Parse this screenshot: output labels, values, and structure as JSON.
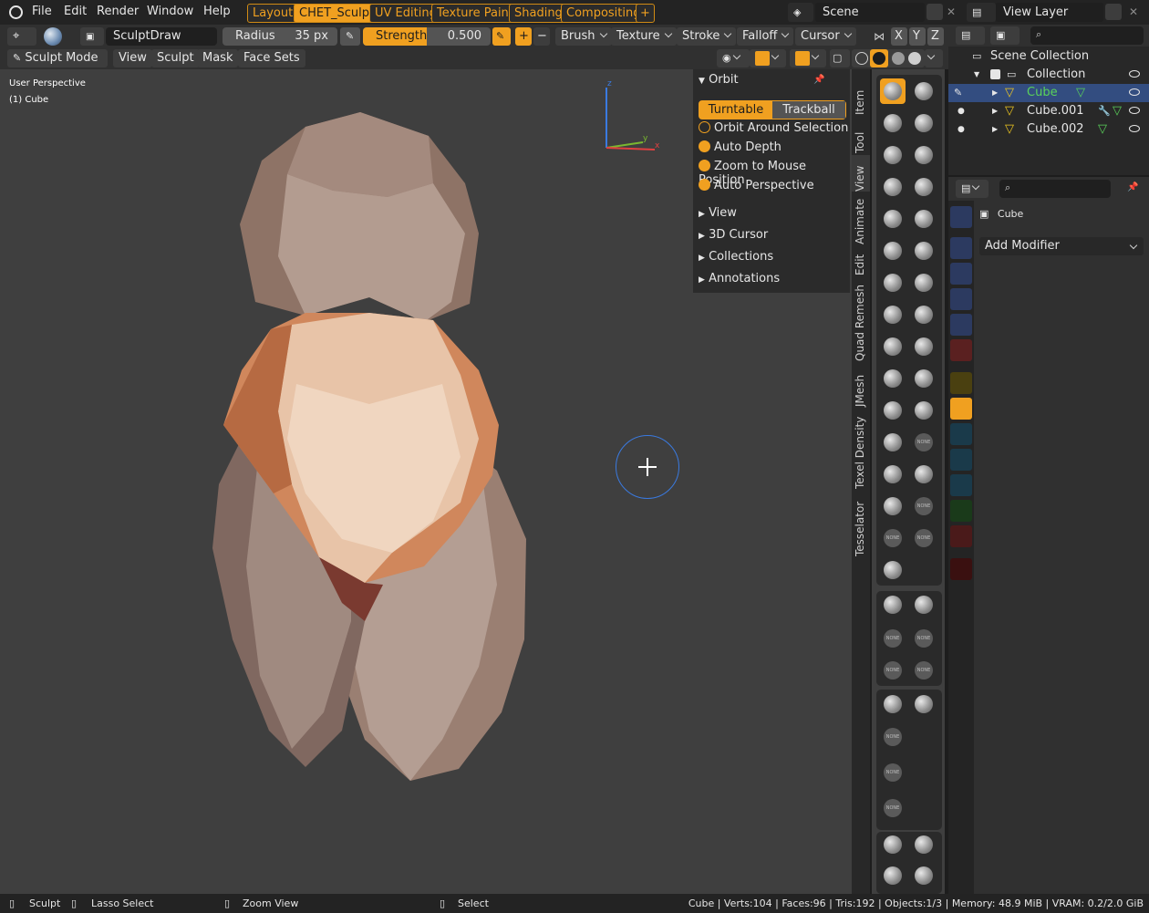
{
  "topbar": {
    "menu": [
      "File",
      "Edit",
      "Render",
      "Window",
      "Help"
    ],
    "workspaces": [
      "Layout",
      "CHET_Sculpt",
      "UV Editing",
      "Texture Paint",
      "Shading",
      "Compositing",
      "+"
    ],
    "active_workspace": "CHET_Sculpt",
    "scene": "Scene",
    "view_layer": "View Layer"
  },
  "tool_header": {
    "brush_name": "SculptDraw",
    "radius_label": "Radius",
    "radius_value": "35 px",
    "strength_label": "Strength",
    "strength_value": "0.500",
    "add_label": "+",
    "sub_label": "−",
    "brush_menu": "Brush",
    "texture_menu": "Texture",
    "stroke_menu": "Stroke",
    "falloff_menu": "Falloff",
    "cursor_menu": "Cursor",
    "axes": [
      "X",
      "Y",
      "Z"
    ]
  },
  "mode_header": {
    "mode": "Sculpt Mode",
    "menus": [
      "View",
      "Sculpt",
      "Mask",
      "Face Sets"
    ]
  },
  "viewport": {
    "perspective": "User Perspective",
    "object": "(1) Cube",
    "gizmo_x": "x",
    "gizmo_y": "y",
    "gizmo_z": "z"
  },
  "npanel": {
    "section": "Orbit",
    "turntable": "Turntable",
    "trackball": "Trackball",
    "options": [
      {
        "label": "Orbit Around Selection",
        "on": false
      },
      {
        "label": "Auto Depth",
        "on": true
      },
      {
        "label": "Zoom to Mouse Position",
        "on": true
      },
      {
        "label": "Auto Perspective",
        "on": true
      }
    ],
    "collapsed": [
      "View",
      "3D Cursor",
      "Collections",
      "Annotations"
    ]
  },
  "vtabs": [
    "Item",
    "Tool",
    "View",
    "Animate",
    "Edit",
    "Quad Remesh",
    "JMesh",
    "Texel Density",
    "Tesselator"
  ],
  "active_vtab": "View",
  "toolbar": {
    "none_label": "NONE"
  },
  "outliner": {
    "scene_collection": "Scene Collection",
    "collection": "Collection",
    "objects": [
      "Cube",
      "Cube.001",
      "Cube.002"
    ]
  },
  "properties": {
    "object_name": "Cube",
    "add_modifier": "Add Modifier"
  },
  "statusbar": {
    "items": [
      "Sculpt",
      "Lasso Select",
      "Zoom View",
      "Select"
    ],
    "stats": "Cube | Verts:104 | Faces:96 | Tris:192 | Objects:1/3 | Memory: 48.9 MiB | VRAM: 0.2/2.0 GiB"
  },
  "colors": {
    "accent": "#f0a020",
    "selection": "#334d80",
    "viewport_bg": "#3f3f3f",
    "mesh_green": "#5ad25a"
  }
}
